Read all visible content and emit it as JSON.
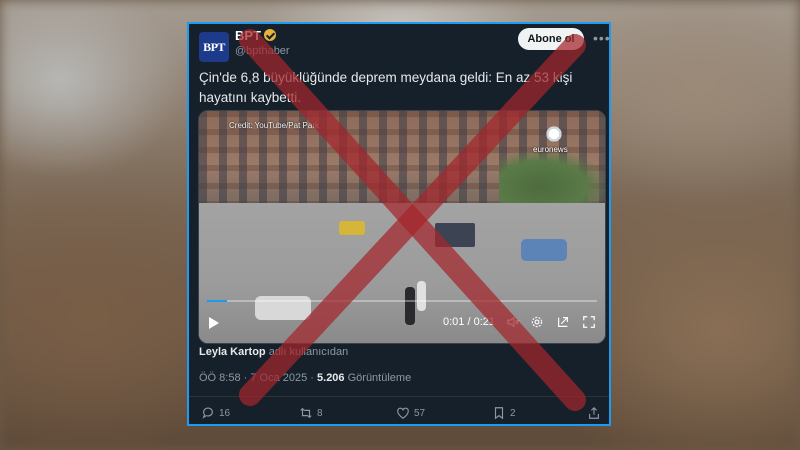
{
  "account": {
    "avatar_text": "BPT",
    "name": "BPT",
    "handle": "@bpthaber",
    "follow_label": "Abone ol",
    "more_label": "•••"
  },
  "tweet": {
    "text": "Çin'de 6,8 büyüklüğünde deprem meydana geldi: En az 53 kişi hayatını kaybetti."
  },
  "video": {
    "credit": "Credit: YouTube/Pat Park",
    "channel": "euronews",
    "time": "0:01 / 0:21",
    "progress": 0.05
  },
  "source": {
    "user": "Leyla Kartop",
    "suffix": " adlı kullanıcıdan"
  },
  "meta": {
    "timestamp": "ÖÖ 8:58 · 7 Oca 2025 · ",
    "views": "5.206",
    "views_label": " Görüntüleme"
  },
  "actions": {
    "replies": "16",
    "reposts": "8",
    "likes": "57",
    "bookmarks": "2"
  },
  "colors": {
    "cross": "#a4262c",
    "frame": "#1d9bf0",
    "verified": "#e8b339"
  }
}
